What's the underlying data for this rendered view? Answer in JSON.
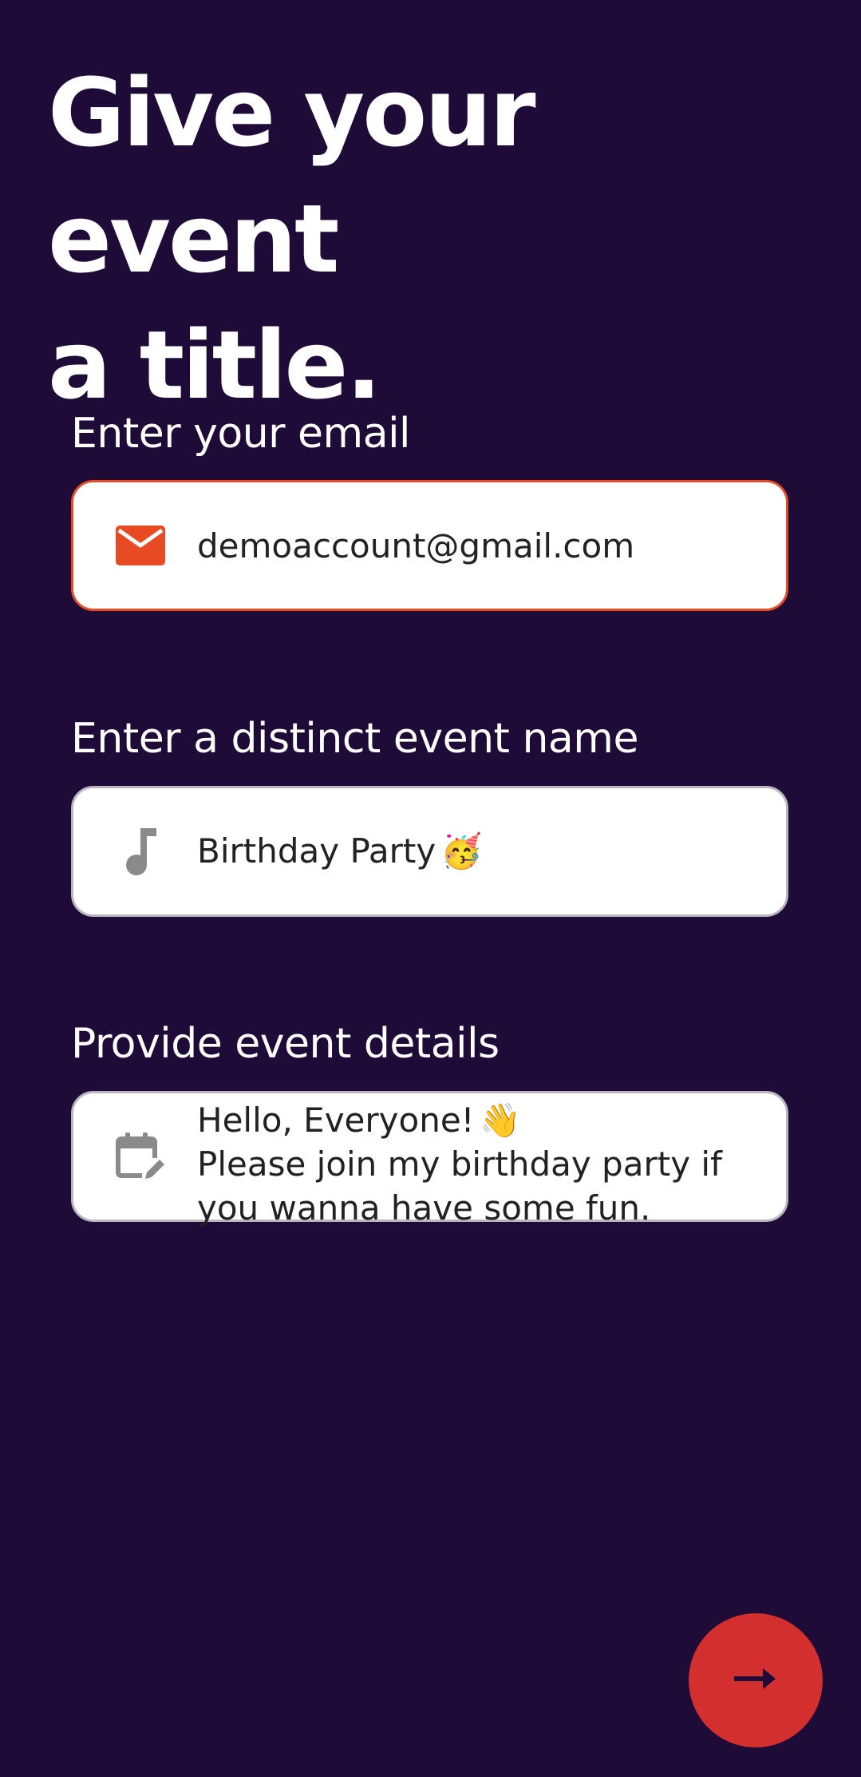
{
  "header": {
    "title_line1": "Give your event",
    "title_line2": "a title."
  },
  "form": {
    "email": {
      "label": "Enter your email",
      "value": "demoaccount@gmail.com",
      "icon": "mail-icon"
    },
    "event_name": {
      "label": "Enter a distinct event name",
      "value": "Birthday Party",
      "emoji": "🥳",
      "icon": "music-note-icon"
    },
    "details": {
      "label": "Provide event details",
      "line1": "Hello, Everyone!",
      "line1_emoji": "👋",
      "line2": "Please join my birthday party if you wanna have some fun.",
      "icon": "calendar-edit-icon"
    }
  },
  "actions": {
    "next_icon": "arrow-right-icon"
  },
  "colors": {
    "background": "#1e0b38",
    "accent": "#e84b24",
    "button": "#d32f2f",
    "icon_inactive": "#8a8a8a"
  }
}
